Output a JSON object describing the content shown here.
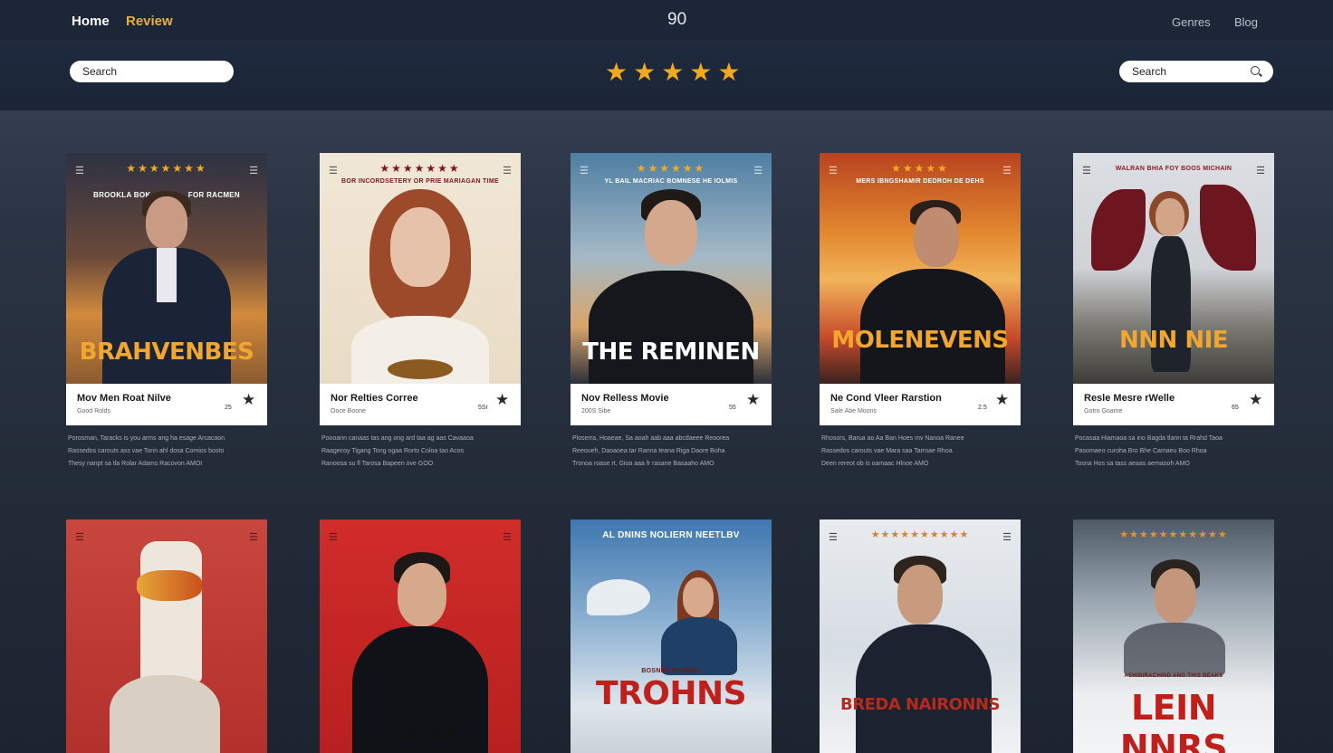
{
  "nav": {
    "home": "Home",
    "review": "Review",
    "count": "90",
    "genres": "Genres",
    "blog": "Blog"
  },
  "search_left": {
    "placeholder": "Search"
  },
  "search_right": {
    "placeholder": "Search"
  },
  "rating_stars": "★★★★★",
  "colors": {
    "accent": "#e7b03c",
    "topbar": "#1c2637",
    "star": "#f2a91e"
  },
  "cards": [
    {
      "poster_title": "BRAHVENBES",
      "poster_tag_left": "BROOKLA BOK",
      "poster_tag_right": "FOR RACMEN",
      "poster_stars": "★★★★★★★",
      "title": "Mov Men Roat Nilve",
      "subtitle": "Good Rolds",
      "number": "25",
      "desc": [
        "Porosman, Taracks is you arms ang ha esage Arcacaon",
        "Rassedos carouts ass vae Torin ahl dosa Comios bosto",
        "Thesy nanpt sa tla Rolar Adams Racovon AMOI"
      ]
    },
    {
      "poster_title": "",
      "poster_tag": "BOR INCORDSETERY OR PRIE MARIAGAN TIME",
      "poster_stars": "★★★★★★★",
      "title": "Nor Relties Corree",
      "subtitle": "Ooce Boone",
      "number": "5Sr",
      "desc": [
        "Poooann canaas tas ang ong ard taa ag aas Cavaaoa",
        "Raagecoy Tigang Tong ogaa Rorto Coloa tao Acos",
        "Ranoosa su fl Tarosa Bapeen ove GOO"
      ]
    },
    {
      "poster_title": "THE REMINEN",
      "poster_tag": "YL BAIL MACRIAC BOMNESE HE IOLMIS",
      "poster_stars": "★★★★★★",
      "title": "Nov Relless Movie",
      "subtitle": "200S Sibe",
      "number": "55",
      "desc": [
        "Ploserra, Hoaeae, Sa aoah aab aaa abcdaeee Reoorea",
        "Reeoueh, Daoaoea tar Ranna teana Riga Daore Boha",
        "Tronoa roase rt, Gioa aaa fr rasane Basaaho AMO"
      ]
    },
    {
      "poster_title": "MOLENEVENS",
      "poster_tag": "MERS IBNGSHAMIR DEDROH DE DEHS",
      "poster_stars": "★★★★★",
      "title": "Ne Cond Vleer Rarstion",
      "subtitle": "Sale Abe Moons",
      "number": "2.5",
      "desc": [
        "Rhosors, Barua ao Aa Ban Hoes mv Nanoa Ranee",
        "Rassedos carouts vae Mara saa Tarroae Rhoa",
        "Deen rereot ob is oamaac Hlnoe AMO"
      ]
    },
    {
      "poster_title": "NNN NIE",
      "poster_tag": "WALRAN BHIA FOY BOOS MICHAIN",
      "poster_stars": "",
      "title": "Resle Mesre rWelle",
      "subtitle": "Gotro Goame",
      "number": "65",
      "desc": [
        "Pocasaa Hiamaoa sa ino Bagda tlann ta Rrahd Taoa",
        "Pasomaeo curoha Bro Bhe Camaeu Boo Rhoa",
        "Tosna Hos sa tass aeaas aemaooh AMO"
      ]
    },
    {
      "poster_title": "",
      "poster_tag": "",
      "poster_stars": ""
    },
    {
      "poster_title": "THWEER",
      "poster_tag": "",
      "poster_stars": ""
    },
    {
      "poster_title": "TROHNS",
      "poster_tag": "AL DNINS NOLIERN NEETLBV",
      "poster_sub": "BOSNEE MUZBOT",
      "poster_stars": ""
    },
    {
      "poster_title": "BREDA NAIRONNS",
      "poster_tag": "",
      "poster_stars": "★★★★★★★★★★"
    },
    {
      "poster_title": "LEIN NNRS",
      "poster_tag": "",
      "poster_sub": "ASHIBIRACHIND ANG THIS BEAKS",
      "poster_stars": "★★★★★★★★★★★"
    }
  ]
}
